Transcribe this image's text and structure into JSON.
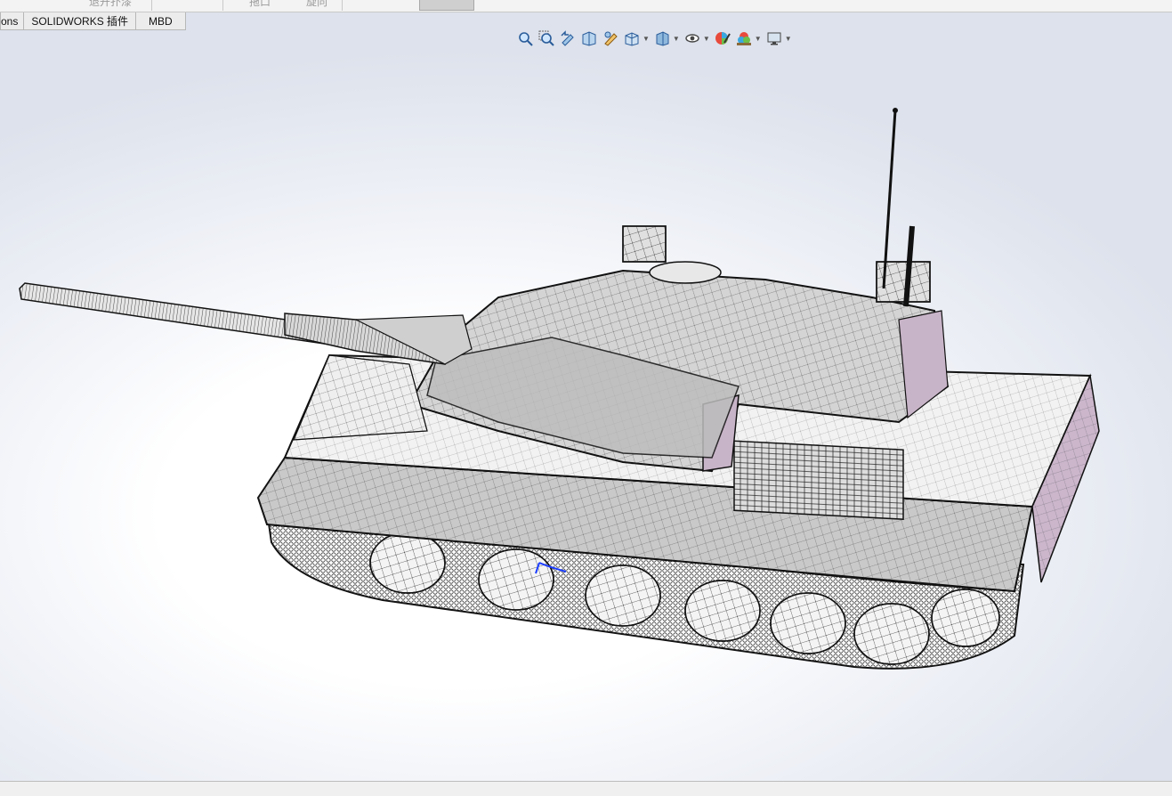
{
  "ribbon": {
    "strip_items": [
      "退开扑漆",
      "拖口",
      "旋向"
    ]
  },
  "tabs": [
    {
      "id": "tab-add-ins",
      "label": "ons"
    },
    {
      "id": "tab-solidworks-plugins",
      "label": "SOLIDWORKS 插件"
    },
    {
      "id": "tab-mbd",
      "label": "MBD"
    }
  ],
  "heads_up_toolbar": {
    "buttons": [
      {
        "name": "zoom-to-fit-icon",
        "dropdown": false
      },
      {
        "name": "zoom-to-area-icon",
        "dropdown": false
      },
      {
        "name": "previous-view-icon",
        "dropdown": false
      },
      {
        "name": "section-view-icon",
        "dropdown": false
      },
      {
        "name": "dynamic-annotation-views-icon",
        "dropdown": false
      },
      {
        "name": "view-orientation-icon",
        "dropdown": true
      },
      {
        "name": "display-style-icon",
        "dropdown": true
      },
      {
        "name": "hide-show-items-icon",
        "dropdown": true
      },
      {
        "name": "edit-appearance-icon",
        "dropdown": false
      },
      {
        "name": "apply-scene-icon",
        "dropdown": true
      },
      {
        "name": "view-settings-icon",
        "dropdown": true
      }
    ]
  },
  "model": {
    "name": "tank-model",
    "display_mode": "shaded-with-edges",
    "colors": {
      "body": "#c4c4c4",
      "body_light": "#e6e6e6",
      "accent_face": "#c8b4c8",
      "edges": "#1a1a1a",
      "triad": "#1a3cff"
    }
  },
  "colors": {
    "viewport_top": "#dde2ec",
    "viewport_center": "#ffffff",
    "tab_bg": "#ececec"
  }
}
